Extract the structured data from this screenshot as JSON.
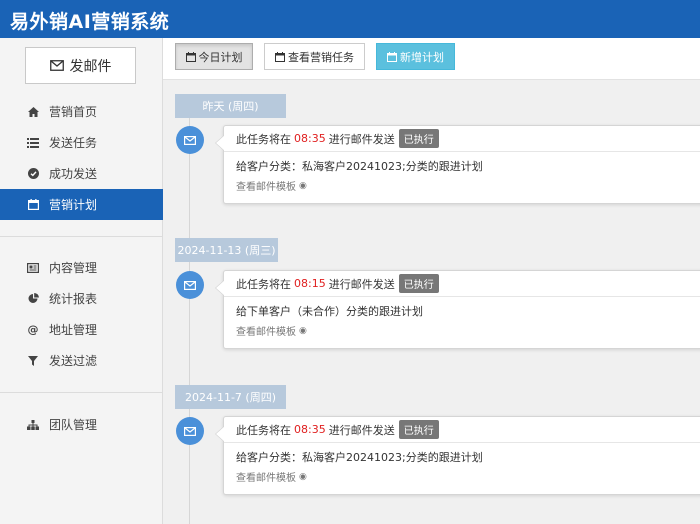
{
  "app": {
    "title": "易外销AI营销系统"
  },
  "sidebar": {
    "compose_label": "发邮件",
    "items": [
      {
        "label": "营销首页",
        "icon": "home-icon"
      },
      {
        "label": "发送任务",
        "icon": "list-icon"
      },
      {
        "label": "成功发送",
        "icon": "check-circle-icon"
      },
      {
        "label": "营销计划",
        "icon": "calendar-icon",
        "active": true
      },
      {
        "label": "内容管理",
        "icon": "newspaper-icon"
      },
      {
        "label": "统计报表",
        "icon": "pie-chart-icon"
      },
      {
        "label": "地址管理",
        "icon": "at-icon"
      },
      {
        "label": "发送过滤",
        "icon": "filter-icon"
      },
      {
        "label": "团队管理",
        "icon": "sitemap-icon"
      }
    ]
  },
  "toolbar": {
    "today_label": "今日计划",
    "view_label": "查看营销任务",
    "add_label": "新增计划"
  },
  "timeline": [
    {
      "date": "昨天 (周四)",
      "prefix": "此任务将在",
      "time": "08:35",
      "suffix": "进行邮件发送",
      "status": "已执行",
      "desc": "给客户分类：私海客户20241023;分类的跟进计划",
      "link": "查看邮件模板"
    },
    {
      "date": "2024-11-13 (周三)",
      "prefix": "此任务将在",
      "time": "08:15",
      "suffix": "进行邮件发送",
      "status": "已执行",
      "desc": "给下单客户（未合作）分类的跟进计划",
      "link": "查看邮件模板"
    },
    {
      "date": "2024-11-7 (周四)",
      "prefix": "此任务将在",
      "time": "08:35",
      "suffix": "进行邮件发送",
      "status": "已执行",
      "desc": "给客户分类：私海客户20241023;分类的跟进计划",
      "link": "查看邮件模板"
    }
  ],
  "colors": {
    "brand": "#1a63b6",
    "timeline_dot": "#4a90d9",
    "date_pill": "#b7c9dc",
    "time_red": "#e02020",
    "badge": "#777777",
    "info_button": "#5bc0de"
  }
}
